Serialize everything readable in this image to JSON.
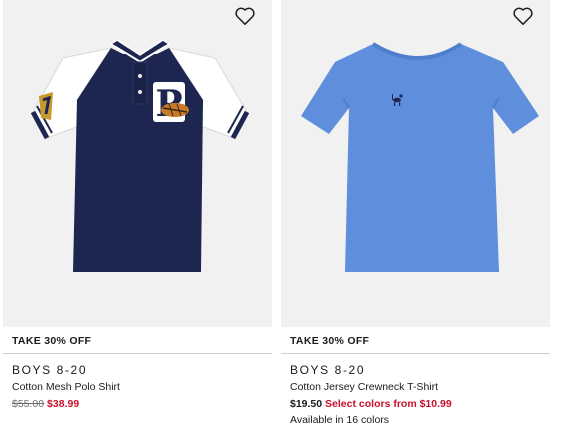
{
  "products": [
    {
      "promo": "TAKE 30% OFF",
      "category": "BOYS 8-20",
      "name": "Cotton Mesh Polo Shirt",
      "price_original": "$55.00",
      "price_sale": "$38.99",
      "polo_letter": "P",
      "wishlist_icon": "heart-outline-icon"
    },
    {
      "promo": "TAKE 30% OFF",
      "category": "BOYS 8-20",
      "name": "Cotton Jersey Crewneck T-Shirt",
      "price_regular": "$19.50",
      "price_select": "Select colors from $10.99",
      "colors_available": "Available in 16 colors",
      "wishlist_icon": "heart-outline-icon"
    }
  ],
  "colors": {
    "sale_red": "#c8102e",
    "navy": "#1d2650",
    "tee_blue": "#5f8fdc",
    "image_bg": "#f1f1f1"
  }
}
